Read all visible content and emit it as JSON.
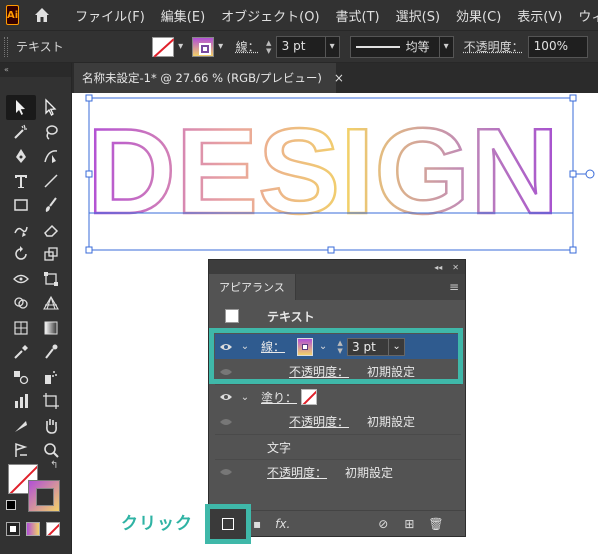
{
  "app": {
    "logo": "Ai"
  },
  "menu": [
    "ファイル(F)",
    "編集(E)",
    "オブジェクト(O)",
    "書式(T)",
    "選択(S)",
    "効果(C)",
    "表示(V)",
    "ウィン"
  ],
  "control_bar": {
    "label": "テキスト",
    "stroke_label": "線：",
    "stroke_weight": "3 pt",
    "stroke_profile": "均等",
    "opacity_label": "不透明度：",
    "opacity_value": "100%"
  },
  "document_tab": {
    "title": "名称未設定-1* @ 27.66 % (RGB/プレビュー)",
    "close": "×"
  },
  "canvas": {
    "artwork_text": "DESIGN",
    "gradient_colors": [
      "#b14fd6",
      "#e9a3a0",
      "#f2d16a",
      "#c08ab7",
      "#a64fd0"
    ]
  },
  "appearance_panel": {
    "tab_label": "アピアランス",
    "header_label": "テキスト",
    "rows": {
      "stroke_label": "線：",
      "stroke_weight": "3 pt",
      "stroke_opacity_label": "不透明度：",
      "stroke_opacity_value": "初期設定",
      "fill_label": "塗り：",
      "fill_opacity_label": "不透明度：",
      "fill_opacity_value": "初期設定",
      "characters_label": "文字",
      "char_opacity_label": "不透明度：",
      "char_opacity_value": "初期設定"
    },
    "footer_fx": "fx."
  },
  "annotation": {
    "click_label": "クリック"
  },
  "colors": {
    "accent": "#3fb8a9",
    "selection": "#2f5b8f",
    "bounding_box": "#3a6bd8"
  }
}
